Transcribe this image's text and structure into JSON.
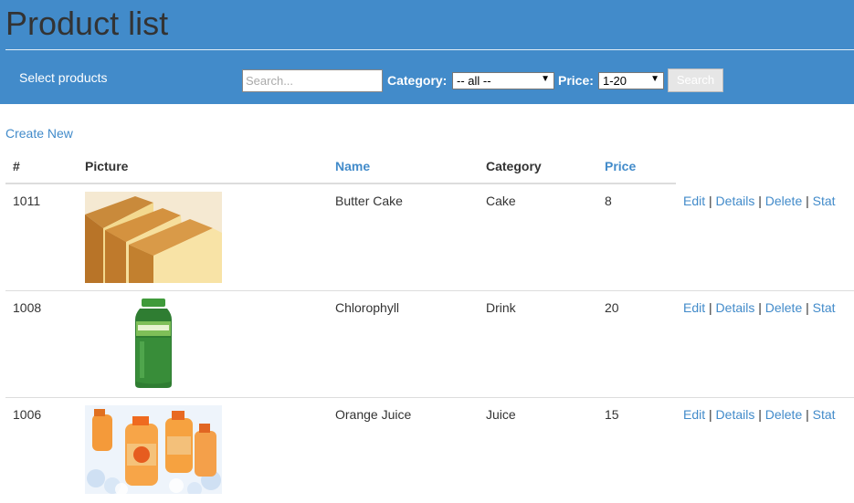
{
  "header": {
    "title": "Product list",
    "subtitle": "Select products",
    "search_placeholder": "Search...",
    "category_label": "Category:",
    "category_selected": "-- all --",
    "price_label": "Price:",
    "price_selected": "1-20",
    "search_button": "Search"
  },
  "create_new": "Create New",
  "table": {
    "columns": [
      "#",
      "Picture",
      "Name",
      "Category",
      "Price"
    ],
    "sortable": [
      "Name",
      "Price"
    ],
    "rows": [
      {
        "id": "1011",
        "picture": "butter-cake-image",
        "name": "Butter Cake",
        "category": "Cake",
        "price": "8"
      },
      {
        "id": "1008",
        "picture": "chlorophyll-bottle-image",
        "name": "Chlorophyll",
        "category": "Drink",
        "price": "20"
      },
      {
        "id": "1006",
        "picture": "orange-juice-bottles-image",
        "name": "Orange Juice",
        "category": "Juice",
        "price": "15"
      }
    ],
    "actions": {
      "edit": "Edit",
      "details": "Details",
      "delete": "Delete",
      "stat": "Stat",
      "separator": "|"
    }
  },
  "colors": {
    "header_bg": "#428bca",
    "link": "#428bca",
    "border": "#dddddd"
  }
}
